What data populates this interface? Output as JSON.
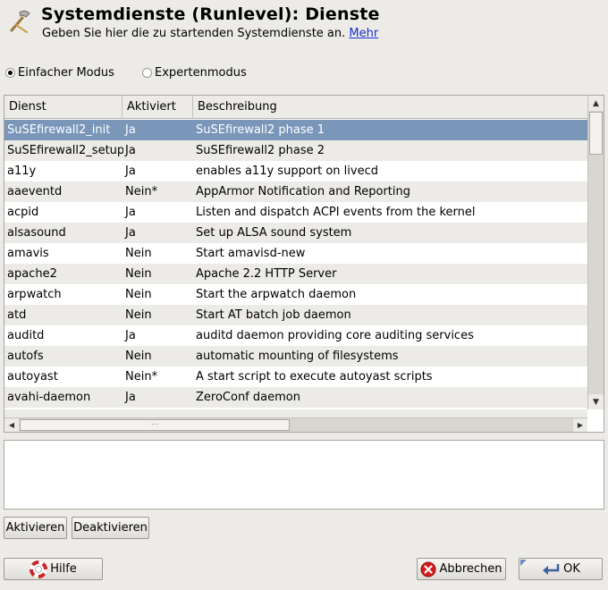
{
  "header": {
    "title": "Systemdienste (Runlevel): Dienste",
    "subtitle": "Geben Sie hier die zu startenden Systemdienste an.",
    "more_link": "Mehr"
  },
  "mode": {
    "simple_label": "Einfacher Modus",
    "expert_label": "Expertenmodus",
    "selected": "simple"
  },
  "table": {
    "columns": [
      "Dienst",
      "Aktiviert",
      "Beschreibung"
    ],
    "rows": [
      {
        "service": "SuSEfirewall2_init",
        "enabled": "Ja",
        "description": "SuSEfirewall2 phase 1"
      },
      {
        "service": "SuSEfirewall2_setup",
        "enabled": "Ja",
        "description": "SuSEfirewall2 phase 2"
      },
      {
        "service": "a11y",
        "enabled": "Ja",
        "description": "enables a11y support on livecd"
      },
      {
        "service": "aaeventd",
        "enabled": "Nein*",
        "description": "AppArmor Notification and Reporting"
      },
      {
        "service": "acpid",
        "enabled": "Ja",
        "description": "Listen and dispatch ACPI events from the kernel"
      },
      {
        "service": "alsasound",
        "enabled": "Ja",
        "description": "Set up ALSA sound system"
      },
      {
        "service": "amavis",
        "enabled": "Nein",
        "description": "Start amavisd-new"
      },
      {
        "service": "apache2",
        "enabled": "Nein",
        "description": "Apache 2.2 HTTP Server"
      },
      {
        "service": "arpwatch",
        "enabled": "Nein",
        "description": "Start the arpwatch daemon"
      },
      {
        "service": "atd",
        "enabled": "Nein",
        "description": "Start AT batch job daemon"
      },
      {
        "service": "auditd",
        "enabled": "Ja",
        "description": "auditd daemon providing core auditing services"
      },
      {
        "service": "autofs",
        "enabled": "Nein",
        "description": "automatic mounting of filesystems"
      },
      {
        "service": "autoyast",
        "enabled": "Nein*",
        "description": "A start script to execute autoyast scripts"
      },
      {
        "service": "avahi-daemon",
        "enabled": "Ja",
        "description": "ZeroConf daemon"
      }
    ],
    "selected_index": 0
  },
  "buttons": {
    "activate": "Aktivieren",
    "deactivate": "Deaktivieren",
    "help": "Hilfe",
    "cancel": "Abbrechen",
    "ok": "OK"
  },
  "icons": {
    "header": "tools-icon",
    "help": "lifebuoy-icon",
    "cancel": "cancel-icon",
    "ok": "enter-arrow-icon"
  },
  "colors": {
    "selection": "#7a96b9",
    "link": "#1a2fd0",
    "cancel_red": "#d41c1c"
  }
}
